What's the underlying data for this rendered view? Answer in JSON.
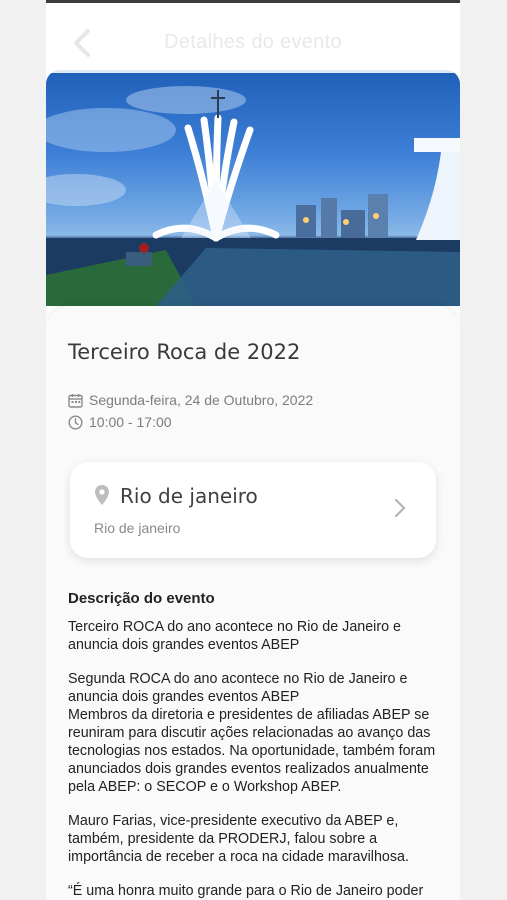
{
  "app_bar": {
    "title": "Detalhes do evento",
    "back_icon": "chevron-left-icon"
  },
  "event": {
    "title": "Terceiro Roca de 2022",
    "date": "Segunda-feira, 24 de Outubro, 2022",
    "time": "10:00 - 17:00"
  },
  "location": {
    "name": "Rio de janeiro",
    "subtitle": "Rio de janeiro"
  },
  "description": {
    "title": "Descrição do evento",
    "paragraphs": [
      "Terceiro ROCA do ano acontece no Rio de Janeiro e anuncia dois grandes eventos ABEP",
      "Segunda ROCA do ano acontece no Rio de Janeiro e anuncia dois grandes eventos ABEP\nMembros da diretoria e presidentes de afiliadas ABEP se reuniram para discutir ações relacionadas ao avanço das tecnologias nos estados. Na oportunidade, também foram anunciados dois grandes eventos realizados anualmente pela ABEP: o SECOP e o Workshop ABEP.",
      "Mauro Farias, vice-presidente executivo da ABEP e, também, presidente da PRODERJ, falou sobre a importância de receber a roca na cidade maravilhosa.",
      "“É uma honra muito grande para o Rio de Janeiro poder receber os líderes das empresas estaduais de"
    ]
  },
  "colors": {
    "accent": "#3a3a3a",
    "muted": "#7d7d7d",
    "sky": "#3d7fd6"
  }
}
